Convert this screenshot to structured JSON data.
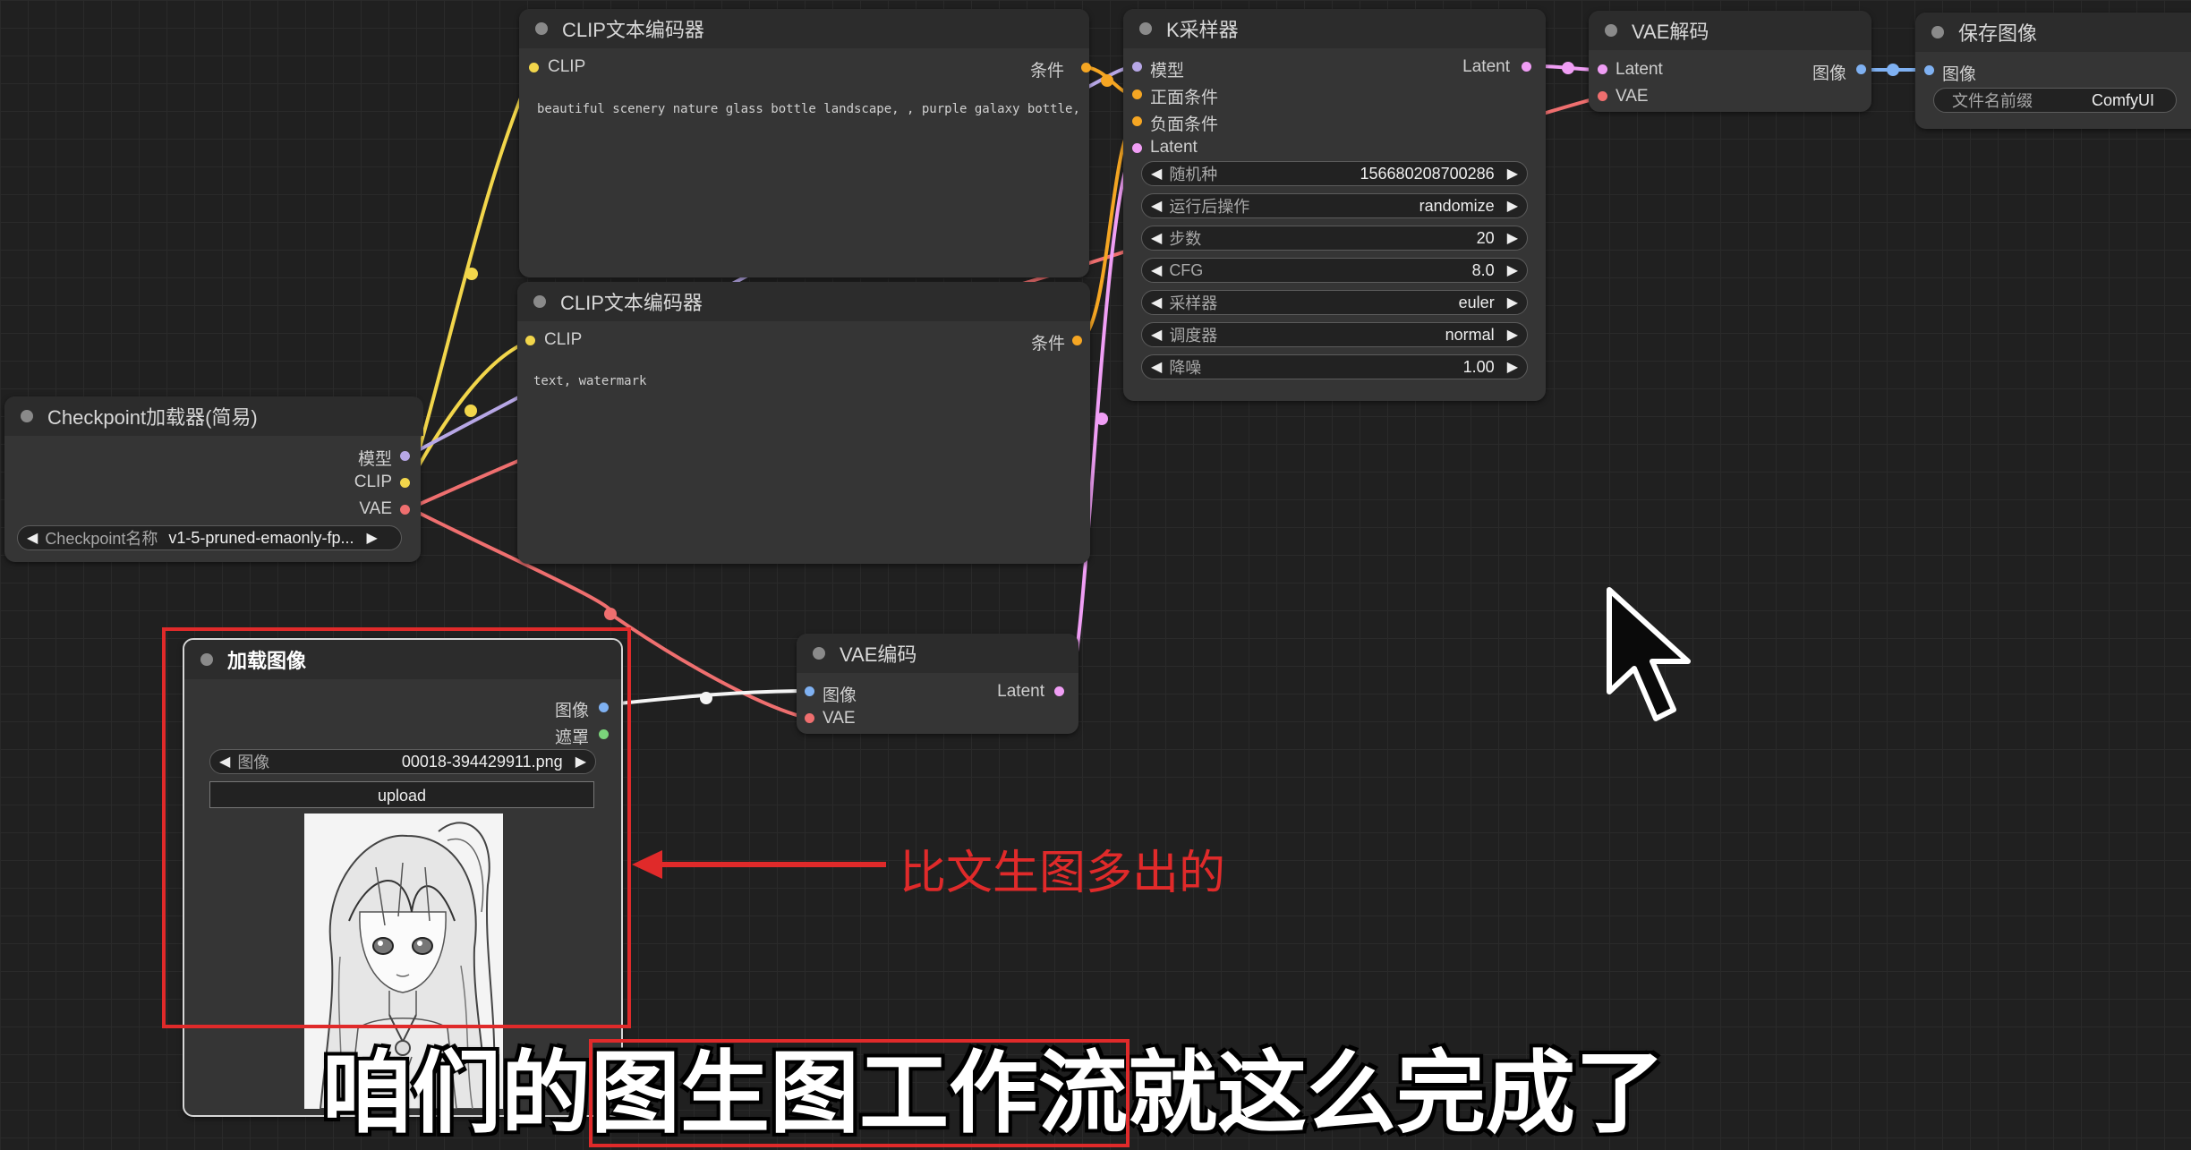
{
  "clip_encoder_1": {
    "title": "CLIP文本编码器",
    "input_clip": "CLIP",
    "output_cond": "条件",
    "prompt": "beautiful scenery nature glass bottle landscape, , purple galaxy bottle,"
  },
  "clip_encoder_2": {
    "title": "CLIP文本编码器",
    "input_clip": "CLIP",
    "output_cond": "条件",
    "prompt": "text, watermark"
  },
  "checkpoint_loader": {
    "title": "Checkpoint加载器(简易)",
    "out_model": "模型",
    "out_clip": "CLIP",
    "out_vae": "VAE",
    "ckpt_label": "Checkpoint名称",
    "ckpt_value": "v1-5-pruned-emaonly-fp..."
  },
  "ksampler": {
    "title": "K采样器",
    "in_model": "模型",
    "in_positive": "正面条件",
    "in_negative": "负面条件",
    "in_latent": "Latent",
    "out_latent": "Latent",
    "widgets": [
      {
        "label": "随机种",
        "value": "156680208700286"
      },
      {
        "label": "运行后操作",
        "value": "randomize"
      },
      {
        "label": "步数",
        "value": "20"
      },
      {
        "label": "CFG",
        "value": "8.0"
      },
      {
        "label": "采样器",
        "value": "euler"
      },
      {
        "label": "调度器",
        "value": "normal"
      },
      {
        "label": "降噪",
        "value": "1.00"
      }
    ]
  },
  "vae_decode": {
    "title": "VAE解码",
    "in_latent": "Latent",
    "in_vae": "VAE",
    "out_image": "图像"
  },
  "save_image": {
    "title": "保存图像",
    "in_image": "图像",
    "prefix_label": "文件名前缀",
    "prefix_value": "ComfyUI"
  },
  "vae_encode": {
    "title": "VAE编码",
    "in_image": "图像",
    "in_vae": "VAE",
    "out_latent": "Latent"
  },
  "load_image": {
    "title": "加载图像",
    "out_image": "图像",
    "out_mask": "遮罩",
    "image_label": "图像",
    "image_value": "00018-394429911.png",
    "upload_label": "upload"
  },
  "annotation": {
    "text": "比文生图多出的",
    "color": "#e02a2a"
  },
  "subtitle": {
    "part1": "咱们的",
    "part2": "图生图工作流",
    "part3": "就这么完成了"
  },
  "link_colors": {
    "clip": "#f2d64b",
    "model": "#b7a7e6",
    "vae": "#ef6f6f",
    "conditioning": "#f5a623",
    "latent": "#f09ef5",
    "image": "#7fb1f2",
    "mask": "#7ad47a"
  }
}
